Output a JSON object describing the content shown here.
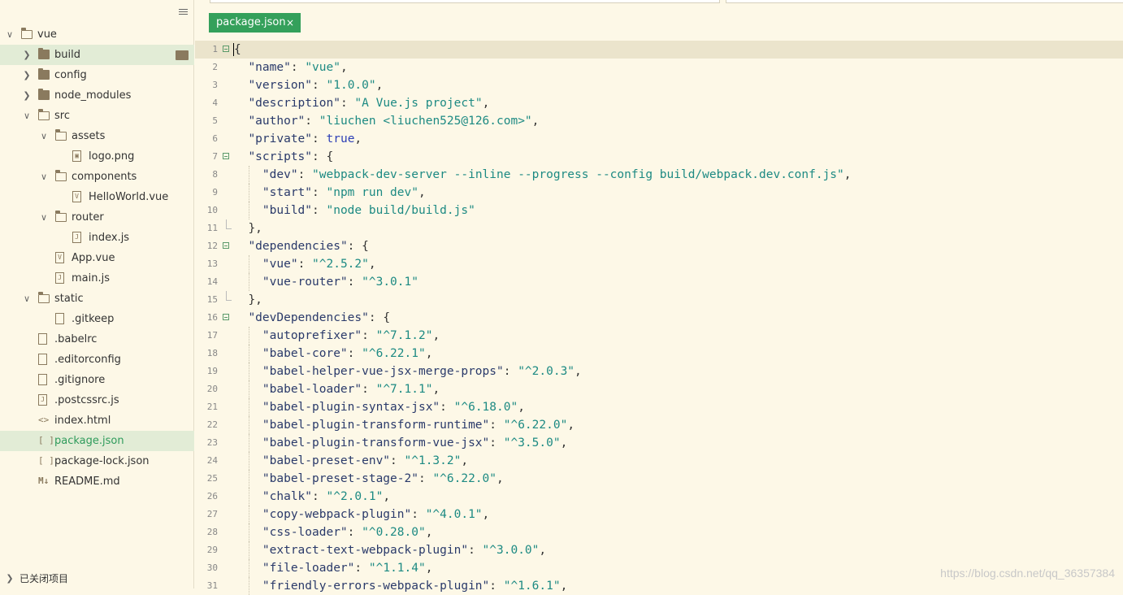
{
  "sidebar": {
    "items": [
      {
        "label": "vue",
        "type": "folder-open",
        "depth": 0,
        "expanded": true
      },
      {
        "label": "build",
        "type": "folder",
        "depth": 1,
        "expanded": false,
        "selected": true
      },
      {
        "label": "config",
        "type": "folder",
        "depth": 1,
        "expanded": false
      },
      {
        "label": "node_modules",
        "type": "folder",
        "depth": 1,
        "expanded": false
      },
      {
        "label": "src",
        "type": "folder-open",
        "depth": 1,
        "expanded": true
      },
      {
        "label": "assets",
        "type": "folder-open",
        "depth": 2,
        "expanded": true
      },
      {
        "label": "logo.png",
        "type": "image",
        "depth": 3
      },
      {
        "label": "components",
        "type": "folder-open",
        "depth": 2,
        "expanded": true
      },
      {
        "label": "HelloWorld.vue",
        "type": "vue",
        "depth": 3
      },
      {
        "label": "router",
        "type": "folder-open",
        "depth": 2,
        "expanded": true
      },
      {
        "label": "index.js",
        "type": "js",
        "depth": 3
      },
      {
        "label": "App.vue",
        "type": "vue",
        "depth": 2
      },
      {
        "label": "main.js",
        "type": "js",
        "depth": 2
      },
      {
        "label": "static",
        "type": "folder-open",
        "depth": 1,
        "expanded": true
      },
      {
        "label": ".gitkeep",
        "type": "file",
        "depth": 2
      },
      {
        "label": ".babelrc",
        "type": "file",
        "depth": 1
      },
      {
        "label": ".editorconfig",
        "type": "file",
        "depth": 1
      },
      {
        "label": ".gitignore",
        "type": "file",
        "depth": 1
      },
      {
        "label": ".postcssrc.js",
        "type": "js",
        "depth": 1
      },
      {
        "label": "index.html",
        "type": "html",
        "depth": 1
      },
      {
        "label": "package.json",
        "type": "json",
        "depth": 1,
        "active": true
      },
      {
        "label": "package-lock.json",
        "type": "json",
        "depth": 1
      },
      {
        "label": "README.md",
        "type": "md",
        "depth": 1
      }
    ],
    "footer_label": "已关闭项目"
  },
  "tabs": [
    {
      "label": "package.json",
      "close": "×"
    }
  ],
  "editor": {
    "lines": [
      {
        "n": "1",
        "fold": "open",
        "indent": 0,
        "tokens": [
          [
            "p",
            "{"
          ]
        ]
      },
      {
        "n": "2",
        "indent": 1,
        "tokens": [
          [
            "k",
            "\"name\""
          ],
          [
            "p",
            ": "
          ],
          [
            "s",
            "\"vue\""
          ],
          [
            "p",
            ","
          ]
        ]
      },
      {
        "n": "3",
        "indent": 1,
        "tokens": [
          [
            "k",
            "\"version\""
          ],
          [
            "p",
            ": "
          ],
          [
            "s",
            "\"1.0.0\""
          ],
          [
            "p",
            ","
          ]
        ]
      },
      {
        "n": "4",
        "indent": 1,
        "tokens": [
          [
            "k",
            "\"description\""
          ],
          [
            "p",
            ": "
          ],
          [
            "s",
            "\"A Vue.js project\""
          ],
          [
            "p",
            ","
          ]
        ]
      },
      {
        "n": "5",
        "indent": 1,
        "tokens": [
          [
            "k",
            "\"author\""
          ],
          [
            "p",
            ": "
          ],
          [
            "s",
            "\"liuchen <liuchen525@126.com>\""
          ],
          [
            "p",
            ","
          ]
        ]
      },
      {
        "n": "6",
        "indent": 1,
        "tokens": [
          [
            "k",
            "\"private\""
          ],
          [
            "p",
            ": "
          ],
          [
            "b",
            "true"
          ],
          [
            "p",
            ","
          ]
        ]
      },
      {
        "n": "7",
        "fold": "open",
        "indent": 1,
        "tokens": [
          [
            "k",
            "\"scripts\""
          ],
          [
            "p",
            ": {"
          ]
        ]
      },
      {
        "n": "8",
        "indent": 2,
        "tokens": [
          [
            "k",
            "\"dev\""
          ],
          [
            "p",
            ": "
          ],
          [
            "s",
            "\"webpack-dev-server --inline --progress --config build/webpack.dev.conf.js\""
          ],
          [
            "p",
            ","
          ]
        ]
      },
      {
        "n": "9",
        "indent": 2,
        "tokens": [
          [
            "k",
            "\"start\""
          ],
          [
            "p",
            ": "
          ],
          [
            "s",
            "\"npm run dev\""
          ],
          [
            "p",
            ","
          ]
        ]
      },
      {
        "n": "10",
        "indent": 2,
        "tokens": [
          [
            "k",
            "\"build\""
          ],
          [
            "p",
            ": "
          ],
          [
            "s",
            "\"node build/build.js\""
          ]
        ]
      },
      {
        "n": "11",
        "fold": "end",
        "indent": 1,
        "tokens": [
          [
            "p",
            "},"
          ]
        ]
      },
      {
        "n": "12",
        "fold": "open",
        "indent": 1,
        "tokens": [
          [
            "k",
            "\"dependencies\""
          ],
          [
            "p",
            ": {"
          ]
        ]
      },
      {
        "n": "13",
        "indent": 2,
        "tokens": [
          [
            "k",
            "\"vue\""
          ],
          [
            "p",
            ": "
          ],
          [
            "s",
            "\"^2.5.2\""
          ],
          [
            "p",
            ","
          ]
        ]
      },
      {
        "n": "14",
        "indent": 2,
        "tokens": [
          [
            "k",
            "\"vue-router\""
          ],
          [
            "p",
            ": "
          ],
          [
            "s",
            "\"^3.0.1\""
          ]
        ]
      },
      {
        "n": "15",
        "fold": "end",
        "indent": 1,
        "tokens": [
          [
            "p",
            "},"
          ]
        ]
      },
      {
        "n": "16",
        "fold": "open",
        "indent": 1,
        "tokens": [
          [
            "k",
            "\"devDependencies\""
          ],
          [
            "p",
            ": {"
          ]
        ]
      },
      {
        "n": "17",
        "indent": 2,
        "tokens": [
          [
            "k",
            "\"autoprefixer\""
          ],
          [
            "p",
            ": "
          ],
          [
            "s",
            "\"^7.1.2\""
          ],
          [
            "p",
            ","
          ]
        ]
      },
      {
        "n": "18",
        "indent": 2,
        "tokens": [
          [
            "k",
            "\"babel-core\""
          ],
          [
            "p",
            ": "
          ],
          [
            "s",
            "\"^6.22.1\""
          ],
          [
            "p",
            ","
          ]
        ]
      },
      {
        "n": "19",
        "indent": 2,
        "tokens": [
          [
            "k",
            "\"babel-helper-vue-jsx-merge-props\""
          ],
          [
            "p",
            ": "
          ],
          [
            "s",
            "\"^2.0.3\""
          ],
          [
            "p",
            ","
          ]
        ]
      },
      {
        "n": "20",
        "indent": 2,
        "tokens": [
          [
            "k",
            "\"babel-loader\""
          ],
          [
            "p",
            ": "
          ],
          [
            "s",
            "\"^7.1.1\""
          ],
          [
            "p",
            ","
          ]
        ]
      },
      {
        "n": "21",
        "indent": 2,
        "tokens": [
          [
            "k",
            "\"babel-plugin-syntax-jsx\""
          ],
          [
            "p",
            ": "
          ],
          [
            "s",
            "\"^6.18.0\""
          ],
          [
            "p",
            ","
          ]
        ]
      },
      {
        "n": "22",
        "indent": 2,
        "tokens": [
          [
            "k",
            "\"babel-plugin-transform-runtime\""
          ],
          [
            "p",
            ": "
          ],
          [
            "s",
            "\"^6.22.0\""
          ],
          [
            "p",
            ","
          ]
        ]
      },
      {
        "n": "23",
        "indent": 2,
        "tokens": [
          [
            "k",
            "\"babel-plugin-transform-vue-jsx\""
          ],
          [
            "p",
            ": "
          ],
          [
            "s",
            "\"^3.5.0\""
          ],
          [
            "p",
            ","
          ]
        ]
      },
      {
        "n": "24",
        "indent": 2,
        "tokens": [
          [
            "k",
            "\"babel-preset-env\""
          ],
          [
            "p",
            ": "
          ],
          [
            "s",
            "\"^1.3.2\""
          ],
          [
            "p",
            ","
          ]
        ]
      },
      {
        "n": "25",
        "indent": 2,
        "tokens": [
          [
            "k",
            "\"babel-preset-stage-2\""
          ],
          [
            "p",
            ": "
          ],
          [
            "s",
            "\"^6.22.0\""
          ],
          [
            "p",
            ","
          ]
        ]
      },
      {
        "n": "26",
        "indent": 2,
        "tokens": [
          [
            "k",
            "\"chalk\""
          ],
          [
            "p",
            ": "
          ],
          [
            "s",
            "\"^2.0.1\""
          ],
          [
            "p",
            ","
          ]
        ]
      },
      {
        "n": "27",
        "indent": 2,
        "tokens": [
          [
            "k",
            "\"copy-webpack-plugin\""
          ],
          [
            "p",
            ": "
          ],
          [
            "s",
            "\"^4.0.1\""
          ],
          [
            "p",
            ","
          ]
        ]
      },
      {
        "n": "28",
        "indent": 2,
        "tokens": [
          [
            "k",
            "\"css-loader\""
          ],
          [
            "p",
            ": "
          ],
          [
            "s",
            "\"^0.28.0\""
          ],
          [
            "p",
            ","
          ]
        ]
      },
      {
        "n": "29",
        "indent": 2,
        "tokens": [
          [
            "k",
            "\"extract-text-webpack-plugin\""
          ],
          [
            "p",
            ": "
          ],
          [
            "s",
            "\"^3.0.0\""
          ],
          [
            "p",
            ","
          ]
        ]
      },
      {
        "n": "30",
        "indent": 2,
        "tokens": [
          [
            "k",
            "\"file-loader\""
          ],
          [
            "p",
            ": "
          ],
          [
            "s",
            "\"^1.1.4\""
          ],
          [
            "p",
            ","
          ]
        ]
      },
      {
        "n": "31",
        "indent": 2,
        "tokens": [
          [
            "k",
            "\"friendly-errors-webpack-plugin\""
          ],
          [
            "p",
            ": "
          ],
          [
            "s",
            "\"^1.6.1\""
          ],
          [
            "p",
            ","
          ]
        ]
      }
    ]
  },
  "watermark": "https://blog.csdn.net/qq_36357384",
  "colors": {
    "tab_bg": "#34a05b",
    "editor_bg": "#fdf8e7",
    "string": "#1d8a83",
    "key": "#2a3a6a",
    "bool": "#2c3eb5",
    "selected_row": "#e2ecd6"
  }
}
